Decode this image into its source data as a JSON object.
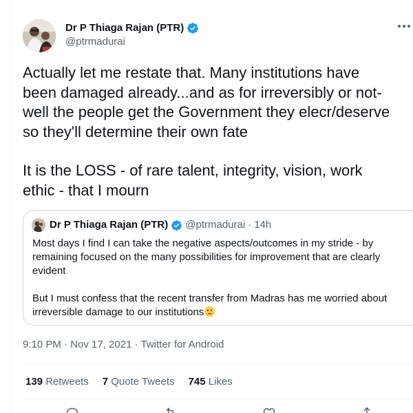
{
  "author": {
    "name": "Dr P Thiaga Rajan (PTR)",
    "handle": "@ptrmadurai"
  },
  "tweet": {
    "lines": [
      "Actually let me restate that. Many institutions have",
      "been damaged already...and as for irreversibly or not-",
      "well the people get the Government they elecr/deserve",
      "so they'll determine their own fate",
      "It is the LOSS - of rare talent, integrity, vision, work",
      "ethic - that I mourn"
    ]
  },
  "quoted_tweet": {
    "name": "Dr P Thiaga Rajan (PTR)",
    "handle": "@ptrmadurai",
    "separator": "·",
    "time": "14h",
    "lines": [
      "Most days I find I can take the negative aspects/outcomes in my stride - by",
      "remaining focused on the many possibilities for improvement that are clearly",
      "evident",
      "But I must confess that the recent transfer from Madras has me worried about",
      "irreversible damage to our institutions"
    ]
  },
  "meta": {
    "timestamp": "9:10 PM · Nov 17, 2021 · Twitter for Android"
  },
  "stats": {
    "retweets_count": "139",
    "retweets_label": "Retweets",
    "quote_tweets_count": "7",
    "quote_tweets_label": "Quote Tweets",
    "likes_count": "745",
    "likes_label": "Likes"
  },
  "colors": {
    "verified": "#1d9bf0",
    "text_primary": "#0f1419",
    "text_secondary": "#536471",
    "border": "#cfd9de"
  },
  "icons": [
    "verified-badge-icon",
    "more-icon",
    "crying-face-emoji-icon",
    "reply-icon",
    "retweet-icon",
    "like-icon",
    "share-icon"
  ]
}
